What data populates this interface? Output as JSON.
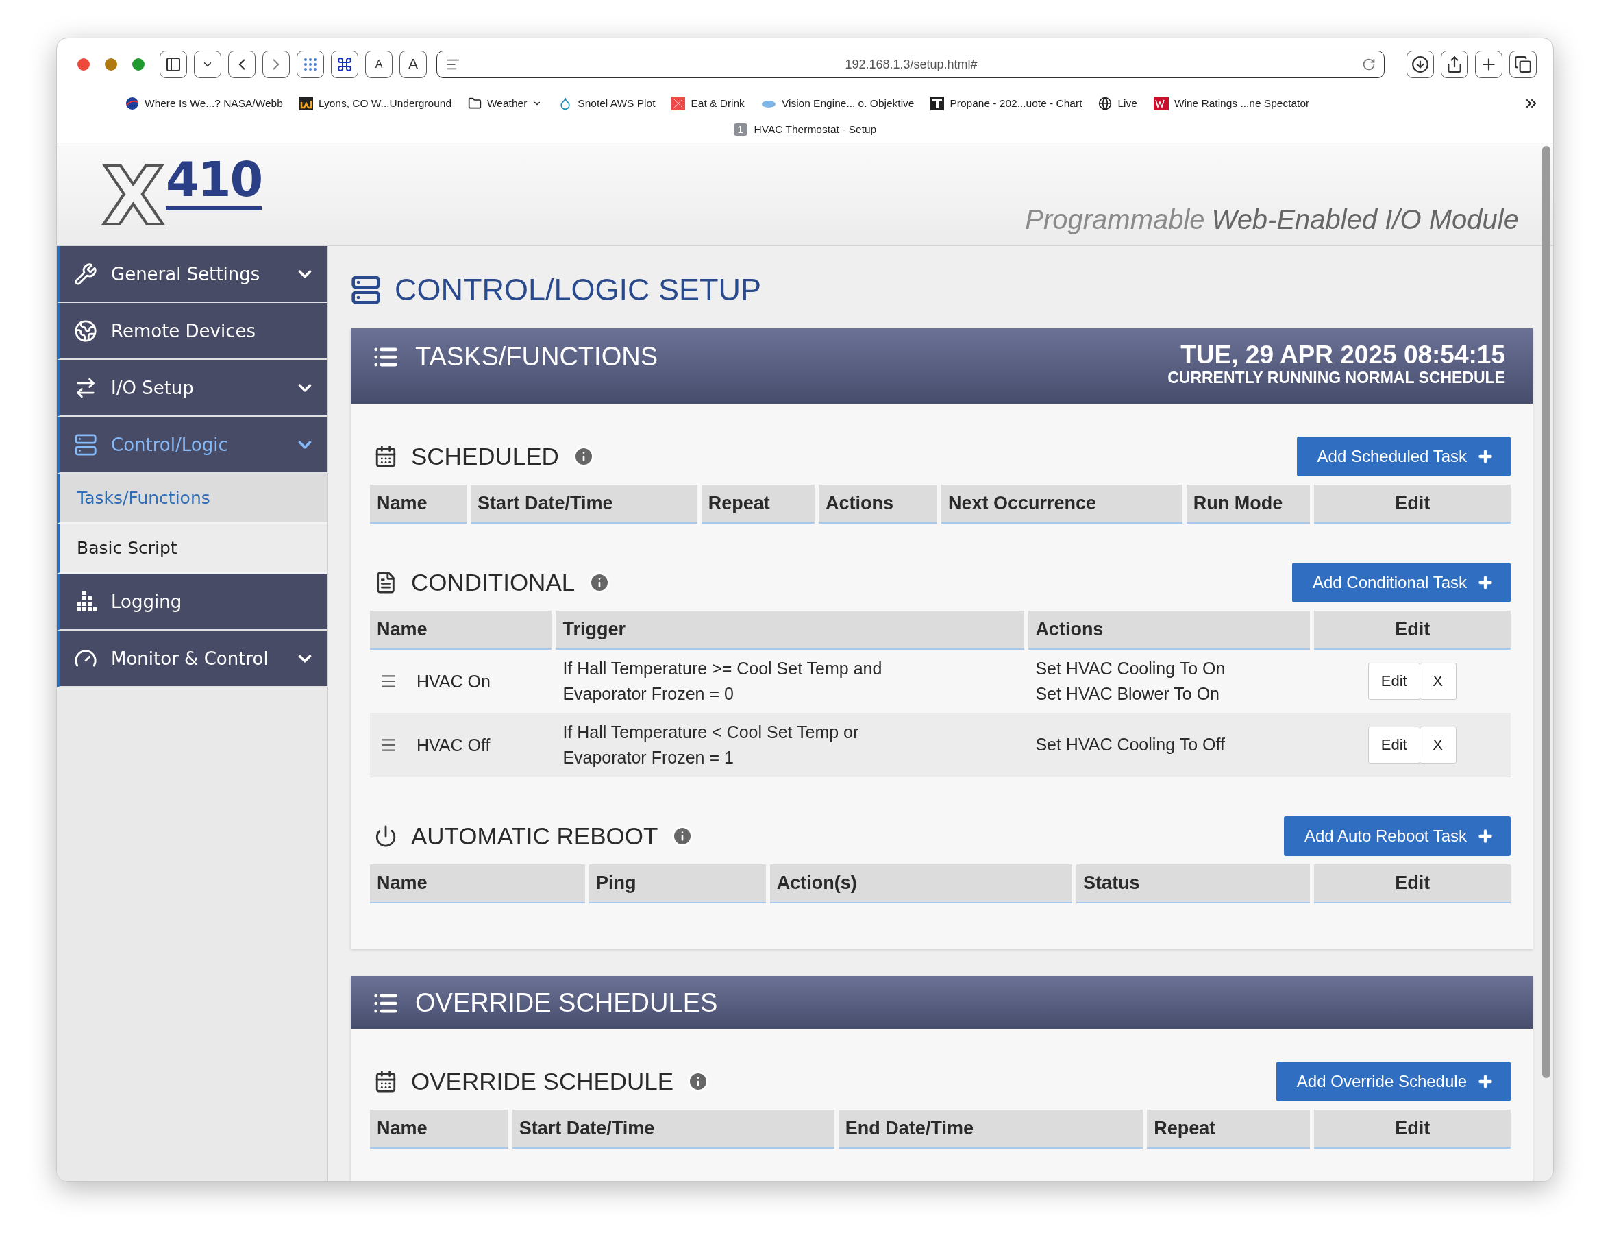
{
  "browser": {
    "url": "192.168.1.3/setup.html#",
    "font_buttons": [
      "A",
      "A"
    ],
    "bookmarks": [
      {
        "kind": "link",
        "label": "Where Is We...? NASA/Webb"
      },
      {
        "kind": "link",
        "label": "Lyons, CO W...Underground"
      },
      {
        "kind": "folder",
        "label": "Weather"
      },
      {
        "kind": "link",
        "label": "Snotel AWS Plot"
      },
      {
        "kind": "link",
        "label": "Eat & Drink"
      },
      {
        "kind": "link",
        "label": "Vision Engine... o. Objektive"
      },
      {
        "kind": "link",
        "label": "Propane - 202...uote - Chart"
      },
      {
        "kind": "link",
        "label": "Live"
      },
      {
        "kind": "link",
        "label": "Wine Ratings ...ne Spectator"
      }
    ],
    "tab": {
      "badge": "1",
      "title": "HVAC Thermostat - Setup"
    }
  },
  "header": {
    "logo_letter": "X",
    "logo_number": "410",
    "tagline_light": "Programmable",
    "tagline_strong": "Web-Enabled I/O Module"
  },
  "sidebar": {
    "items": [
      {
        "label": "General Settings",
        "has_submenu": true,
        "selected": false
      },
      {
        "label": "Remote Devices",
        "has_submenu": false,
        "selected": false
      },
      {
        "label": "I/O Setup",
        "has_submenu": true,
        "selected": false
      },
      {
        "label": "Control/Logic",
        "has_submenu": true,
        "selected": true,
        "children": [
          {
            "label": "Tasks/Functions",
            "selected": true
          },
          {
            "label": "Basic Script",
            "selected": false
          }
        ]
      },
      {
        "label": "Logging",
        "has_submenu": false,
        "selected": false
      },
      {
        "label": "Monitor & Control",
        "has_submenu": true,
        "selected": false
      }
    ]
  },
  "page_title": "CONTROL/LOGIC SETUP",
  "panels": [
    {
      "title": "TASKS/FUNCTIONS",
      "date_time": "TUE, 29 APR 2025 08:54:15",
      "status": "CURRENTLY RUNNING NORMAL SCHEDULE",
      "sections": [
        {
          "title": "SCHEDULED",
          "button": "Add Scheduled Task",
          "columns": [
            "Name",
            "Start Date/Time",
            "Repeat",
            "Actions",
            "Next Occurrence",
            "Run Mode",
            "Edit"
          ]
        },
        {
          "title": "CONDITIONAL",
          "button": "Add Conditional Task",
          "columns": [
            "Name",
            "Trigger",
            "Actions",
            "Edit"
          ],
          "rows": [
            {
              "name": "HVAC On",
              "trigger": [
                "If Hall Temperature >= Cool Set Temp and",
                "Evaporator Frozen = 0"
              ],
              "actions": [
                "Set HVAC Cooling To On",
                "Set HVAC Blower To On"
              ],
              "buttons": [
                "Edit",
                "X"
              ]
            },
            {
              "name": "HVAC Off",
              "trigger": [
                "If Hall Temperature < Cool Set Temp or",
                "Evaporator Frozen = 1"
              ],
              "actions": [
                "Set HVAC Cooling To Off"
              ],
              "buttons": [
                "Edit",
                "X"
              ]
            }
          ]
        },
        {
          "title": "AUTOMATIC REBOOT",
          "button": "Add Auto Reboot Task",
          "columns": [
            "Name",
            "Ping",
            "Action(s)",
            "Status",
            "Edit"
          ]
        }
      ]
    },
    {
      "title": "OVERRIDE SCHEDULES",
      "sections": [
        {
          "title": "OVERRIDE SCHEDULE",
          "button": "Add Override Schedule",
          "columns": [
            "Name",
            "Start Date/Time",
            "End Date/Time",
            "Repeat",
            "Edit"
          ]
        }
      ]
    }
  ]
}
